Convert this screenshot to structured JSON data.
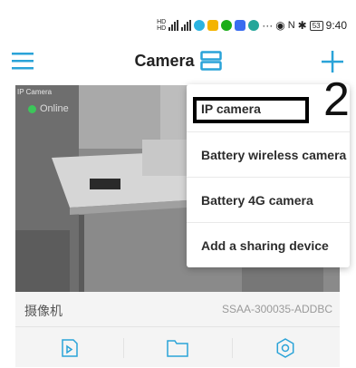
{
  "status_bar": {
    "icons": [
      "hd-icon",
      "signal-icon",
      "signal-icon",
      "app-icons",
      "more-icon",
      "eye-icon",
      "nfc-icon",
      "bluetooth-icon"
    ],
    "battery": "53",
    "time": "9:40"
  },
  "header": {
    "title": "Camera",
    "accent_color": "#2aa3d8"
  },
  "camera": {
    "preview_label": "IP Camera",
    "status": "Online",
    "device_name": "摄像机",
    "device_id": "SSAA-300035-ADDBC",
    "actions": [
      "playback-icon",
      "folder-icon",
      "settings-icon"
    ]
  },
  "menu": {
    "items": [
      {
        "label": "IP camera"
      },
      {
        "label": "Battery wireless camera"
      },
      {
        "label": "Battery 4G camera"
      },
      {
        "label": "Add a sharing device"
      }
    ]
  },
  "annotation": {
    "step": "2"
  }
}
